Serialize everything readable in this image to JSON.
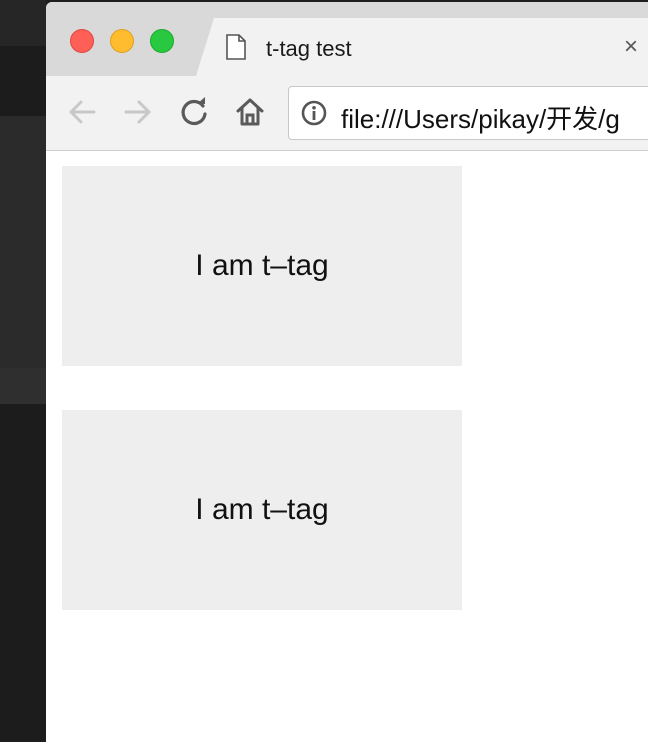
{
  "browser": {
    "tab": {
      "title": "t-tag test",
      "close_glyph": "×",
      "icon": "document-icon"
    },
    "toolbar": {
      "back_icon": "arrow-left-icon",
      "forward_icon": "arrow-right-icon",
      "reload_icon": "reload-icon",
      "home_icon": "home-icon",
      "info_icon": "info-icon"
    },
    "address": {
      "url": "file:///Users/pikay/开发/g"
    },
    "traffic_light_colors": {
      "close": "#fe5f57",
      "minimize": "#febc2e",
      "maximize": "#28c840"
    }
  },
  "page": {
    "boxes": [
      {
        "text": "I am t–tag"
      },
      {
        "text": "I am t–tag"
      }
    ],
    "box_background": "#eeeeee"
  }
}
